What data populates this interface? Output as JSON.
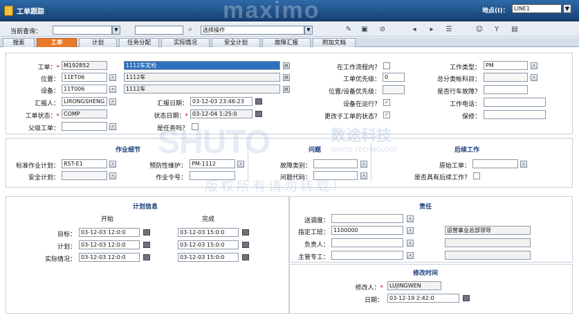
{
  "app": {
    "title": "工单跟踪",
    "brand": "maximo",
    "site_label": "地点(I)：",
    "site_value": "LINE1"
  },
  "toolbar": {
    "query_label": "当前查询：",
    "query_value": "",
    "search_value": "",
    "action_value": "选择操作"
  },
  "tabs": [
    "搜索",
    "工单",
    "计划",
    "任务分配",
    "实际情况",
    "安全计划",
    "故障汇报",
    "附加文档"
  ],
  "active_tab": 1,
  "main": {
    "wo_label": "工单：",
    "wo_value": "M192852",
    "wo_desc": "1112车定检",
    "loc_label": "位置：",
    "loc_value": "11ET06",
    "loc_desc": "1112车",
    "asset_label": "设备：",
    "asset_value": "11T006",
    "asset_desc": "1112车",
    "reporter_label": "汇报人：",
    "reporter_value": "LIRONGSHENG",
    "report_date_label": "汇报日期：",
    "report_date_value": "03-12-03 23:46:23",
    "status_label": "工单状态：",
    "status_value": "COMP",
    "status_date_label": "状态日期：",
    "status_date_value": "03-12-04 1:25:0",
    "parent_label": "父级工单：",
    "parent_value": "",
    "is_task_label": "是任务吗？",
    "in_flow_label": "在工作流程内？",
    "wo_priority_label": "工单优先级：",
    "wo_priority_value": "0",
    "loc_priority_label": "位置/设备优先级：",
    "loc_priority_value": "",
    "asset_running_label": "设备在运行？",
    "change_status_label": "更改子工单的状态？",
    "work_type_label": "工作类型：",
    "work_type_value": "PM",
    "gl_label": "总分类帐科目：",
    "gl_value": "",
    "breakdown_label": "是否行车故障？",
    "breakdown_value": "",
    "phone_label": "工作电话：",
    "phone_value": "",
    "maint_label": "保修：",
    "maint_value": ""
  },
  "job": {
    "title": "作业细节",
    "plan_label": "标准作业计划：",
    "plan_value": "RST-E1",
    "safety_label": "安全计划：",
    "safety_value": "",
    "pm_label": "预防性维护：",
    "pm_value": "PM-1112",
    "cmd_label": "作业令号：",
    "cmd_value": ""
  },
  "problem": {
    "title": "问题",
    "failure_label": "故障类别：",
    "failure_value": "",
    "code_label": "问题代码：",
    "code_value": ""
  },
  "followup": {
    "title": "后续工作",
    "orig_label": "原始工单：",
    "orig_value": "",
    "has_label": "是否具有后续工作？"
  },
  "schedule": {
    "title": "计划信息",
    "start_hd": "开始",
    "finish_hd": "完成",
    "rows": [
      {
        "label": "目标：",
        "start": "03-12-03 12:0:0",
        "finish": "03-12-03 15:0:0"
      },
      {
        "label": "计划：",
        "start": "03-12-03 12:0:0",
        "finish": "03-12-03 15:0:0"
      },
      {
        "label": "实际情况：",
        "start": "03-12-03 12:0:0",
        "finish": "03-12-03 15:0:0"
      }
    ]
  },
  "resp": {
    "title": "责任",
    "dispatch_label": "送调度：",
    "dispatch_value": "",
    "crew_label": "指定工班：",
    "crew_value": "1100000",
    "crew_desc": "运营事业总部领导",
    "owner_label": "负责人：",
    "owner_value": "",
    "owner_desc": "",
    "sup_label": "主管专工：",
    "sup_value": "",
    "sup_desc": ""
  },
  "modify": {
    "title": "修改时间",
    "by_label": "修改人：",
    "by_value": "LUJINGWEN",
    "date_label": "日期：",
    "date_value": "03-12-19 2:42:0"
  },
  "watermark": {
    "logo": "SHUTO",
    "cn": "数途科技",
    "en": "SHUTO TECHNOLOGY",
    "copy": "版权所有请勿转载！"
  }
}
